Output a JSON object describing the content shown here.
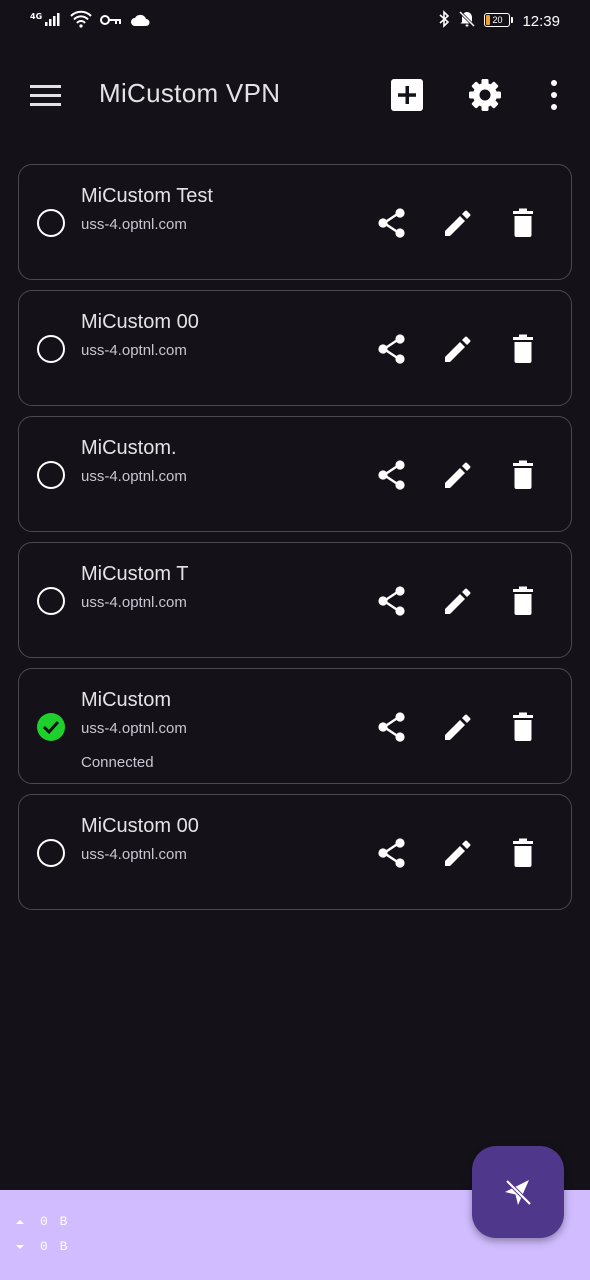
{
  "status_bar": {
    "network": "4G",
    "time": "12:39",
    "battery_level": "20",
    "battery_fraction": 0.2,
    "battery_color": "#f0a030",
    "icons": [
      "signal-icon",
      "wifi-icon",
      "vpn-key-icon",
      "cloud-icon",
      "bluetooth-icon",
      "notifications-off-icon",
      "battery-icon"
    ]
  },
  "app_bar": {
    "title": "MiCustom VPN",
    "icons": [
      "menu-icon",
      "add-box-icon",
      "settings-icon",
      "more-vert-icon"
    ]
  },
  "profiles": [
    {
      "name": "MiCustom Test",
      "host": "uss-4.optnl.com",
      "status": "",
      "selected": false
    },
    {
      "name": "MiCustom 00",
      "host": "uss-4.optnl.com",
      "status": "",
      "selected": false
    },
    {
      "name": "MiCustom.",
      "host": "uss-4.optnl.com",
      "status": "",
      "selected": false
    },
    {
      "name": "MiCustom T",
      "host": "uss-4.optnl.com",
      "status": "",
      "selected": false
    },
    {
      "name": "MiCustom",
      "host": "uss-4.optnl.com",
      "status": "Connected",
      "selected": true
    },
    {
      "name": "MiCustom 00",
      "host": "uss-4.optnl.com",
      "status": "",
      "selected": false
    }
  ],
  "profile_actions": [
    "share-icon",
    "edit-icon",
    "delete-icon"
  ],
  "traffic": {
    "upload": "0 B",
    "download": "0 B"
  },
  "fab": {
    "icon": "navigation-off-icon"
  },
  "colors": {
    "background": "#141218",
    "card_border": "#4a4750",
    "connected_check": "#1ed02b",
    "traffic_bar": "#d0bcff",
    "fab": "#4f378b"
  }
}
